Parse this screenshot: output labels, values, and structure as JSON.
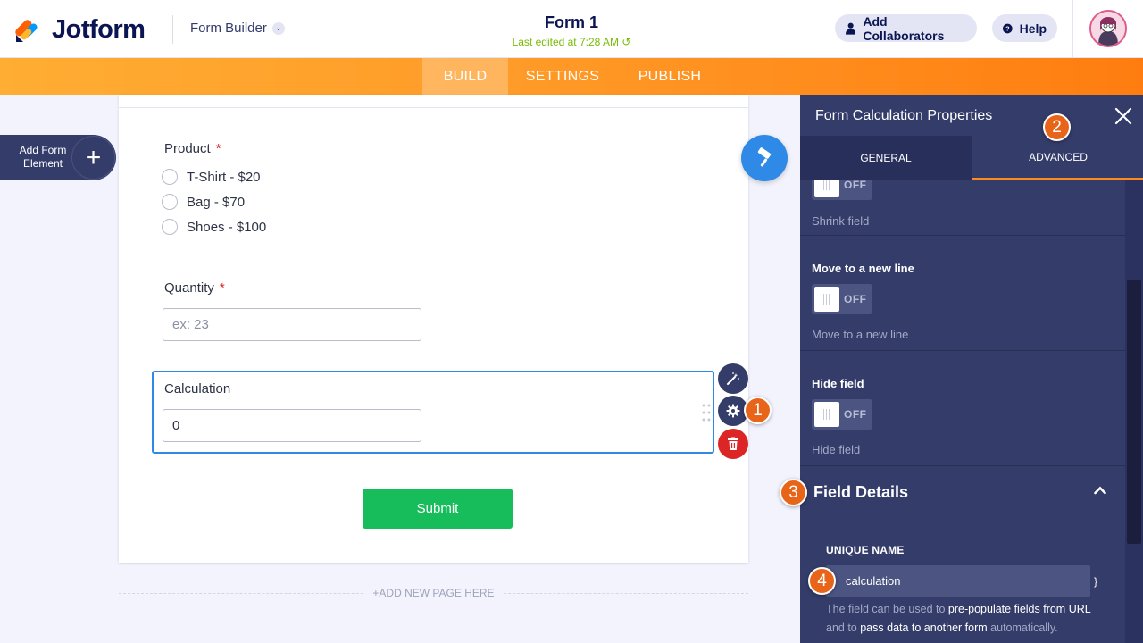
{
  "header": {
    "logo_text": "Jotform",
    "builder_label": "Form Builder",
    "form_title": "Form 1",
    "last_edited": "Last edited at 7:28 AM",
    "collab_label": "Add Collaborators",
    "help_label": "Help"
  },
  "nav": {
    "tabs": [
      "BUILD",
      "SETTINGS",
      "PUBLISH"
    ],
    "active": "BUILD"
  },
  "sidebar": {
    "add_element_line1": "Add Form",
    "add_element_line2": "Element"
  },
  "form": {
    "product": {
      "label": "Product",
      "required_mark": "*",
      "options": [
        "T-Shirt - $20",
        "Bag - $70",
        "Shoes - $100"
      ]
    },
    "quantity": {
      "label": "Quantity",
      "required_mark": "*",
      "placeholder": "ex: 23"
    },
    "calculation": {
      "label": "Calculation",
      "value": "0"
    },
    "submit_label": "Submit",
    "add_page_label": "+ADD NEW PAGE HERE"
  },
  "panel": {
    "title": "Form Calculation Properties",
    "tabs": {
      "general": "GENERAL",
      "advanced": "ADVANCED"
    },
    "toggle_off_label": "OFF",
    "shrink": {
      "sub": "Shrink field"
    },
    "move_line": {
      "title": "Move to a new line",
      "sub": "Move to a new line"
    },
    "hide": {
      "title": "Hide field",
      "sub": "Hide field"
    },
    "field_details_title": "Field Details",
    "unique_name_label": "UNIQUE NAME",
    "unique_name_value": "calculation",
    "unique_name_suffix": "}",
    "desc_1": "The field can be used to ",
    "desc_2": "pre-populate fields from URL",
    "desc_3": " and to ",
    "desc_4": "pass data to another form",
    "desc_5": " automatically."
  },
  "badges": [
    "1",
    "2",
    "3",
    "4"
  ],
  "colors": {
    "brand_orange": "#ff7d10",
    "panel_bg": "#343c6a",
    "submit_green": "#18bd5b",
    "focus_blue": "#2e8ae6",
    "badge_orange": "#e86419"
  }
}
